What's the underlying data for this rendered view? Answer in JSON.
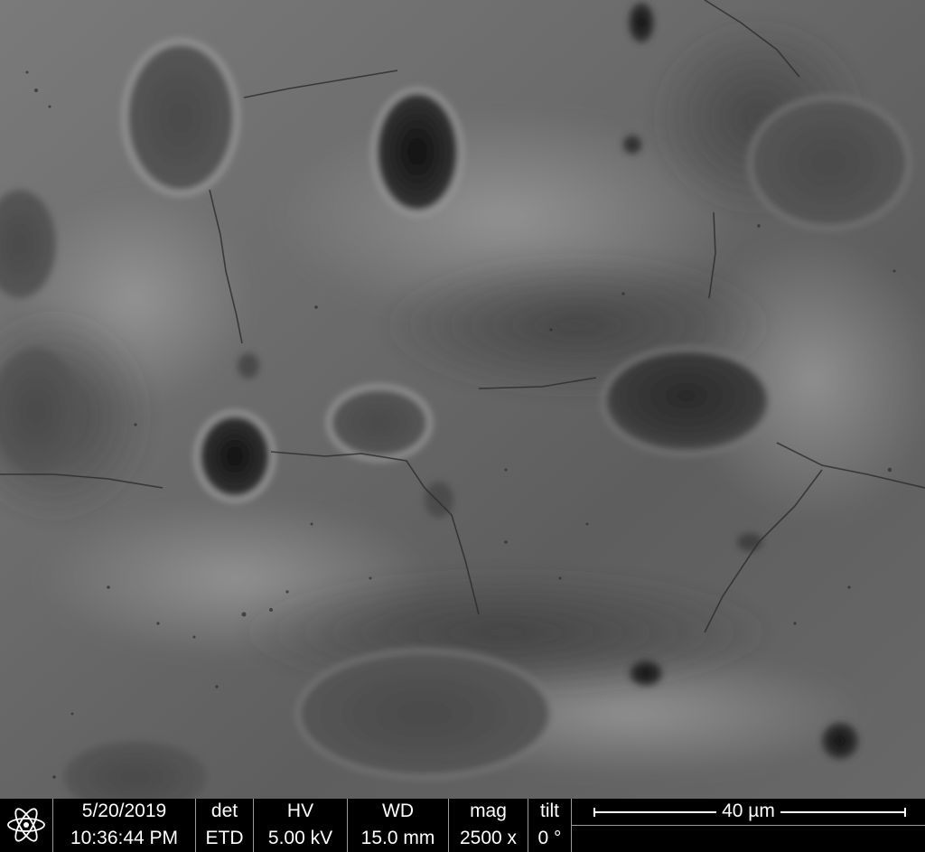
{
  "image": {
    "subject": "micrograph-surface"
  },
  "databar": {
    "date": "5/20/2019",
    "time": "10:36:44 PM",
    "det_label": "det",
    "det_value": "ETD",
    "hv_label": "HV",
    "hv_value": "5.00 kV",
    "wd_label": "WD",
    "wd_value": "15.0 mm",
    "mag_label": "mag",
    "mag_value": "2500 x",
    "tilt_label": "tilt",
    "tilt_value": "0 °",
    "scale_label": "40 µm"
  },
  "icons": {
    "logo": "atom-logo-icon"
  },
  "colors": {
    "background": "#000000",
    "text": "#ffffff",
    "divider": "#9a9a9a"
  }
}
